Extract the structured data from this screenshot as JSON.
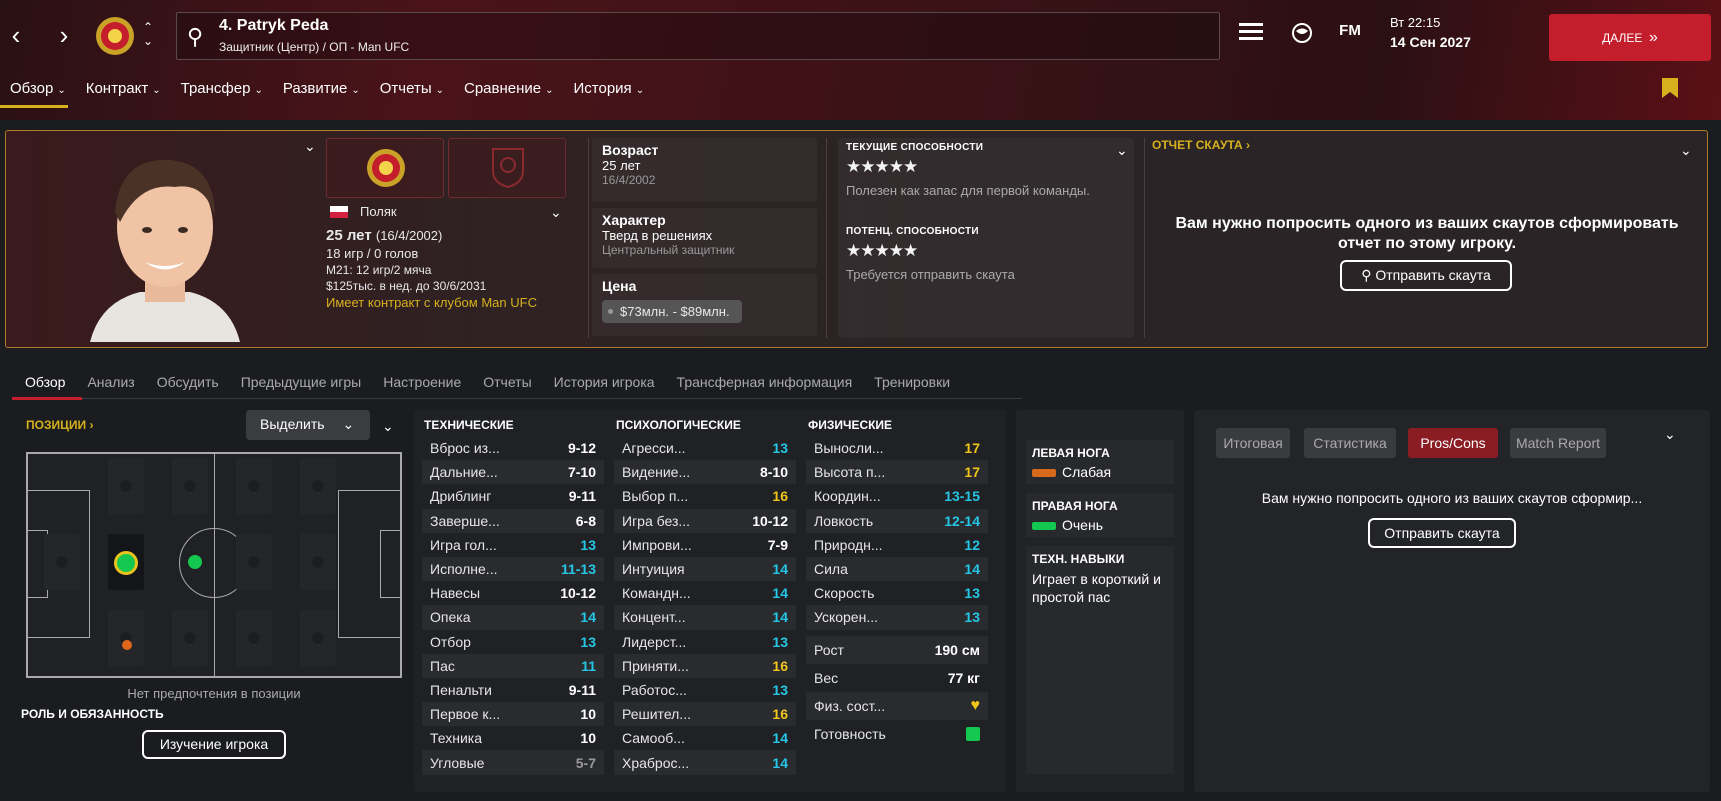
{
  "header": {
    "player_title": "4. Patryk Peda",
    "player_subtitle": "Защитник (Центр) / ОП - Man UFC",
    "date_line1": "Вт 22:15",
    "date_line2": "14 Сен 2027",
    "next_label": "ДАЛЕЕ",
    "fm_label": "FM"
  },
  "main_nav": [
    "Обзор",
    "Контракт",
    "Трансфер",
    "Развитие",
    "Отчеты",
    "Сравнение",
    "История"
  ],
  "profile": {
    "nationality": "Поляк",
    "age": "25 лет",
    "dob": "(16/4/2002)",
    "apps": "18 игр / 0 голов",
    "u21": "М21: 12 игр/2 мяча",
    "wage": "$125тыс. в нед. до 30/6/2031",
    "contract": "Имеет контракт с клубом Man UFC",
    "age_label": "Возраст",
    "age_value": "25 лет",
    "age_dob": "16/4/2002",
    "character_label": "Характер",
    "character_value": "Тверд в решениях",
    "character_role": "Центральный защитник",
    "price_label": "Цена",
    "price_value": "$73млн. - $89млн."
  },
  "abilities": {
    "current_label": "ТЕКУЩИЕ СПОСОБНОСТИ",
    "current_stars": "★★★★★",
    "current_rating": 4.5,
    "current_text": "Полезен как запас для первой команды.",
    "potential_label": "ПОТЕНЦ. СПОСОБНОСТИ",
    "potential_stars": "★★★★★",
    "potential_rating": 4.5,
    "potential_text": "Требуется отправить скаута"
  },
  "scout": {
    "title": "ОТЧЕТ СКАУТА",
    "message_line1": "Вам нужно попросить одного из ваших скаутов сформировать",
    "message_line2": "отчет по этому игроку.",
    "button": "Отправить скаута"
  },
  "sub_tabs": [
    "Обзор",
    "Анализ",
    "Обсудить",
    "Предыдущие игры",
    "Настроение",
    "Отчеты",
    "История игрока",
    "Трансферная информация",
    "Тренировки"
  ],
  "positions": {
    "title": "ПОЗИЦИИ",
    "select_label": "Выделить",
    "no_pref": "Нет предпочтения в позиции",
    "role_title": "РОЛЬ И ОБЯЗАННОСТЬ",
    "study_button": "Изучение игрока"
  },
  "attributes": {
    "technical_title": "ТЕХНИЧЕСКИЕ",
    "mental_title": "ПСИХОЛОГИЧЕСКИЕ",
    "physical_title": "ФИЗИЧЕСКИЕ",
    "technical": [
      {
        "name": "Вброс из...",
        "value": "9-12",
        "color": "white"
      },
      {
        "name": "Дальние...",
        "value": "7-10",
        "color": "white"
      },
      {
        "name": "Дриблинг",
        "value": "9-11",
        "color": "white"
      },
      {
        "name": "Заверше...",
        "value": "6-8",
        "color": "white"
      },
      {
        "name": "Игра гол...",
        "value": "13",
        "color": "cyan"
      },
      {
        "name": "Исполне...",
        "value": "11-13",
        "color": "cyan"
      },
      {
        "name": "Навесы",
        "value": "10-12",
        "color": "white"
      },
      {
        "name": "Опека",
        "value": "14",
        "color": "cyan"
      },
      {
        "name": "Отбор",
        "value": "13",
        "color": "cyan"
      },
      {
        "name": "Пас",
        "value": "11",
        "color": "cyan"
      },
      {
        "name": "Пенальти",
        "value": "9-11",
        "color": "white"
      },
      {
        "name": "Первое к...",
        "value": "10",
        "color": "white"
      },
      {
        "name": "Техника",
        "value": "10",
        "color": "white"
      },
      {
        "name": "Угловые",
        "value": "5-7",
        "color": "grey"
      }
    ],
    "mental": [
      {
        "name": "Агресси...",
        "value": "13",
        "color": "cyan"
      },
      {
        "name": "Видение...",
        "value": "8-10",
        "color": "white"
      },
      {
        "name": "Выбор п...",
        "value": "16",
        "color": "yellow"
      },
      {
        "name": "Игра без...",
        "value": "10-12",
        "color": "white"
      },
      {
        "name": "Импрови...",
        "value": "7-9",
        "color": "white"
      },
      {
        "name": "Интуиция",
        "value": "14",
        "color": "cyan"
      },
      {
        "name": "Командн...",
        "value": "14",
        "color": "cyan"
      },
      {
        "name": "Концент...",
        "value": "14",
        "color": "cyan"
      },
      {
        "name": "Лидерст...",
        "value": "13",
        "color": "cyan"
      },
      {
        "name": "Приняти...",
        "value": "16",
        "color": "yellow"
      },
      {
        "name": "Работос...",
        "value": "13",
        "color": "cyan"
      },
      {
        "name": "Решител...",
        "value": "16",
        "color": "yellow"
      },
      {
        "name": "Самооб...",
        "value": "14",
        "color": "cyan"
      },
      {
        "name": "Храброс...",
        "value": "14",
        "color": "cyan"
      }
    ],
    "physical": [
      {
        "name": "Выносли...",
        "value": "17",
        "color": "yellow"
      },
      {
        "name": "Высота п...",
        "value": "17",
        "color": "yellow"
      },
      {
        "name": "Координ...",
        "value": "13-15",
        "color": "cyan"
      },
      {
        "name": "Ловкость",
        "value": "12-14",
        "color": "cyan"
      },
      {
        "name": "Природн...",
        "value": "12",
        "color": "cyan"
      },
      {
        "name": "Сила",
        "value": "14",
        "color": "cyan"
      },
      {
        "name": "Скорость",
        "value": "13",
        "color": "cyan"
      },
      {
        "name": "Ускорен...",
        "value": "13",
        "color": "cyan"
      }
    ],
    "height_label": "Рост",
    "height_value": "190 см",
    "weight_label": "Вес",
    "weight_value": "77 кг",
    "condition_label": "Физ. сост...",
    "fitness_label": "Готовность"
  },
  "feet": {
    "left_label": "ЛЕВАЯ НОГА",
    "left_value": "Слабая",
    "right_label": "ПРАВАЯ НОГА",
    "right_value": "Очень",
    "tech_label": "ТЕХН. НАВЫКИ",
    "tech_value": "Играет в короткий и простой пас"
  },
  "right_panel": {
    "tabs": [
      "Итоговая",
      "Статистика",
      "Pros/Cons",
      "Match Report"
    ],
    "message": "Вам нужно попросить одного из ваших скаутов сформир...",
    "button": "Отправить скаута"
  },
  "colors": {
    "accent_red": "#c41d2b",
    "gold": "#d6b11d",
    "cyan": "#25c6e6",
    "yellow": "#f0c419"
  }
}
